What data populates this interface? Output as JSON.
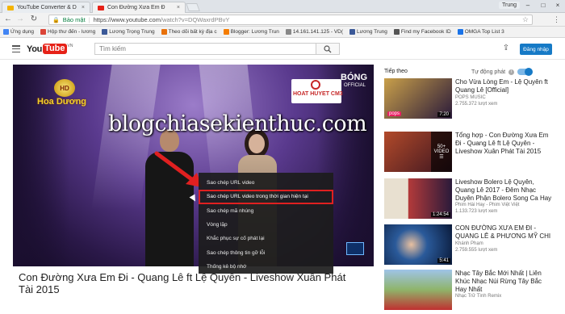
{
  "browser": {
    "tabs": [
      {
        "label": "YouTube Converter & D",
        "close": "×",
        "favicon_color": "#f4b400"
      },
      {
        "label": "Con Đường Xưa Em Đ",
        "close": "×",
        "favicon_color": "#e62117"
      }
    ],
    "user_chip": "Trung",
    "window_controls": {
      "minimize": "–",
      "maximize": "□",
      "close": "×"
    },
    "address": {
      "secure_label": "Bảo mật",
      "url_main": "https://www.youtube.com",
      "url_rest": "/watch?v=DQWaxrdPBvY"
    },
    "bookmarks": [
      {
        "label": "Ứng dụng",
        "color": "#4285f4"
      },
      {
        "label": "Hộp thư đến - lương",
        "color": "#db4437"
      },
      {
        "label": "Lương Trọng Trung",
        "color": "#3b5998"
      },
      {
        "label": "Theo dõi bất kỳ địa c",
        "color": "#e8710a"
      },
      {
        "label": "Blogger: Lương Trun",
        "color": "#f57d00"
      },
      {
        "label": "14.161.141.125 - VD(",
        "color": "#888888"
      },
      {
        "label": "Lương Trung",
        "color": "#3b5998"
      },
      {
        "label": "Find my Facebook ID",
        "color": "#555555"
      },
      {
        "label": "OMGA Top List 3",
        "color": "#1a73e8"
      }
    ]
  },
  "youtube": {
    "logo_you": "You",
    "logo_tube": "Tube",
    "logo_region": "VN",
    "search_placeholder": "Tìm kiếm",
    "signin_label": "Đăng nhập"
  },
  "video": {
    "channel_logo_badge": "HD",
    "channel_logo_text": "Hoa Dương",
    "show_logo_sub": "HOAT HUYET CM3",
    "show_logo_big": "BÓNG",
    "show_logo_small": "OFFICIAL",
    "watermark": "blogchiasekienthuc.com",
    "title": "Con Đường Xưa Em Đi - Quang Lê ft Lệ Quyên - Liveshow Xuân Phát Tài 2015"
  },
  "context_menu": {
    "items": [
      {
        "label": "Sao chép URL video",
        "highlighted": false
      },
      {
        "label": "Sao chép URL video trong thời gian hiện tại",
        "highlighted": true
      },
      {
        "label": "Sao chép mã nhúng",
        "highlighted": false
      },
      {
        "label": "Vòng lặp",
        "highlighted": false
      },
      {
        "label": "Khắc phục sự cố phát lại",
        "highlighted": false
      },
      {
        "label": "Sao chép thông tin gỡ lỗi",
        "highlighted": false
      },
      {
        "label": "Thống kê bộ nhớ",
        "highlighted": false
      }
    ],
    "highlight_color": "#e02020"
  },
  "sidebar": {
    "heading": "Tiếp theo",
    "autoplay_label": "Tự động phát",
    "info_glyph": "i",
    "items": [
      {
        "title": "Cho Vừa Lòng Em - Lệ Quyên ft Quang Lê [Official]",
        "channel": "POPS MUSIC",
        "views": "2.755.372 lượt xem",
        "duration": "7:20",
        "badge": "pops",
        "c1": "#c9a04a",
        "c2": "#2a1a3a"
      },
      {
        "title": "Tổng hợp - Con Đường Xưa Em Đi - Quang Lê ft Lệ Quyên - Liveshow Xuân Phát Tài 2015",
        "channel": "",
        "views": "",
        "duration": "",
        "badge": "50+ VIDEO",
        "c1": "#b24a2a",
        "c2": "#3a1420"
      },
      {
        "title": "Liveshow Bolero Lệ Quyên, Quang Lê 2017 - Đêm Nhạc Duyên Phận Bolero Song Ca Hay",
        "channel": "Phim Hài Hay - Phim Việt Việt",
        "views": "1.133.723 lượt xem",
        "duration": "1:24:54",
        "badge": "",
        "c1": "#e8e0d0",
        "c2": "#b23a3a"
      },
      {
        "title": "CON ĐƯỜNG XƯA EM ĐI -QUANG LÊ & PHƯƠNG MỸ CHI",
        "channel": "Khánh Phạm",
        "views": "2.759.555 lượt xem",
        "duration": "5:41",
        "badge": "",
        "c1": "#2a5a9a",
        "c2": "#0a1a3a"
      },
      {
        "title": "Nhạc Tây Bắc Mới Nhất | Liên Khúc Nhạc Núi Rừng Tây Bắc Hay Nhất",
        "channel": "Nhạc Trữ Tình Remix",
        "views": "",
        "duration": "",
        "badge": "",
        "c1": "#8fb46a",
        "c2": "#c03030"
      }
    ]
  }
}
